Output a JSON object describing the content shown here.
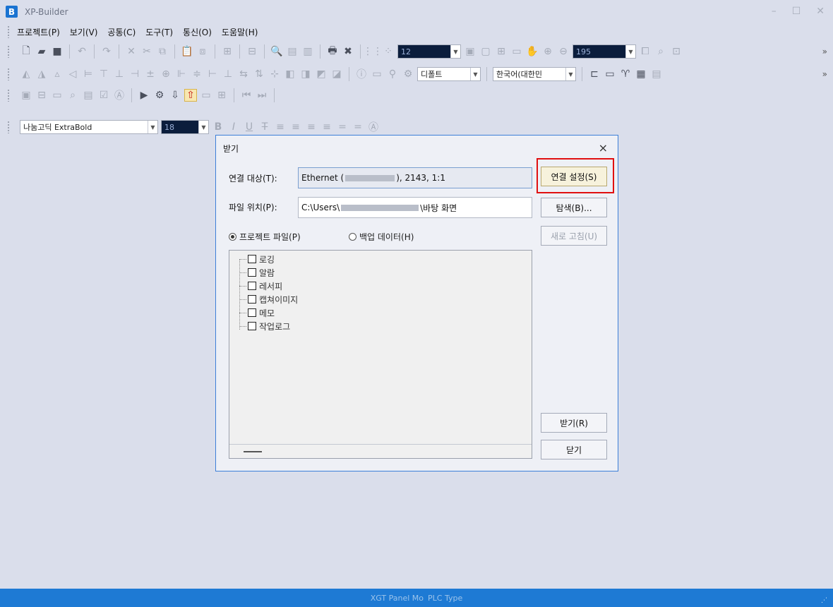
{
  "app": {
    "logo_letter": "B",
    "title": "XP-Builder"
  },
  "window_controls": {
    "minimize": "–",
    "maximize": "☐",
    "close": "✕"
  },
  "menu": [
    "프로젝트(P)",
    "보기(V)",
    "공통(C)",
    "도구(T)",
    "통신(O)",
    "도움말(H)"
  ],
  "toolbar": {
    "zoom_combo_1": "12",
    "zoom_combo_2": "195",
    "font_combo": "디폴트",
    "language_combo": "한국어(대한민",
    "font_name_combo": "나눔고딕 ExtraBold",
    "font_size_combo": "18",
    "format_buttons": [
      "B",
      "I",
      "U",
      "T"
    ]
  },
  "dialog": {
    "title": "받기",
    "close": "×",
    "connection_label": "연결 대상(T):",
    "connection_value_prefix": "Ethernet (",
    "connection_value_suffix": "), 2143, 1:1",
    "connection_settings_button": "연결 설정(S)",
    "file_location_label": "파일 위치(P):",
    "file_location_prefix": "C:\\Users\\",
    "file_location_suffix": "\\바탕 화면",
    "browse_button": "탐색(B)...",
    "refresh_button": "새로 고침(U)",
    "radio_project": "프로젝트 파일(P)",
    "radio_backup": "백업 데이터(H)",
    "selected_radio": "project",
    "tree_items": [
      "로깅",
      "알람",
      "레서피",
      "캡쳐이미지",
      "메모",
      "작업로그"
    ],
    "receive_button": "받기(R)",
    "close_button": "닫기"
  },
  "status": {
    "left": "XGT Panel Mo",
    "right": "PLC Type"
  },
  "colors": {
    "accent": "#1e7ad4",
    "highlight_border": "#e01010",
    "dialog_border": "#3c7fd8"
  }
}
